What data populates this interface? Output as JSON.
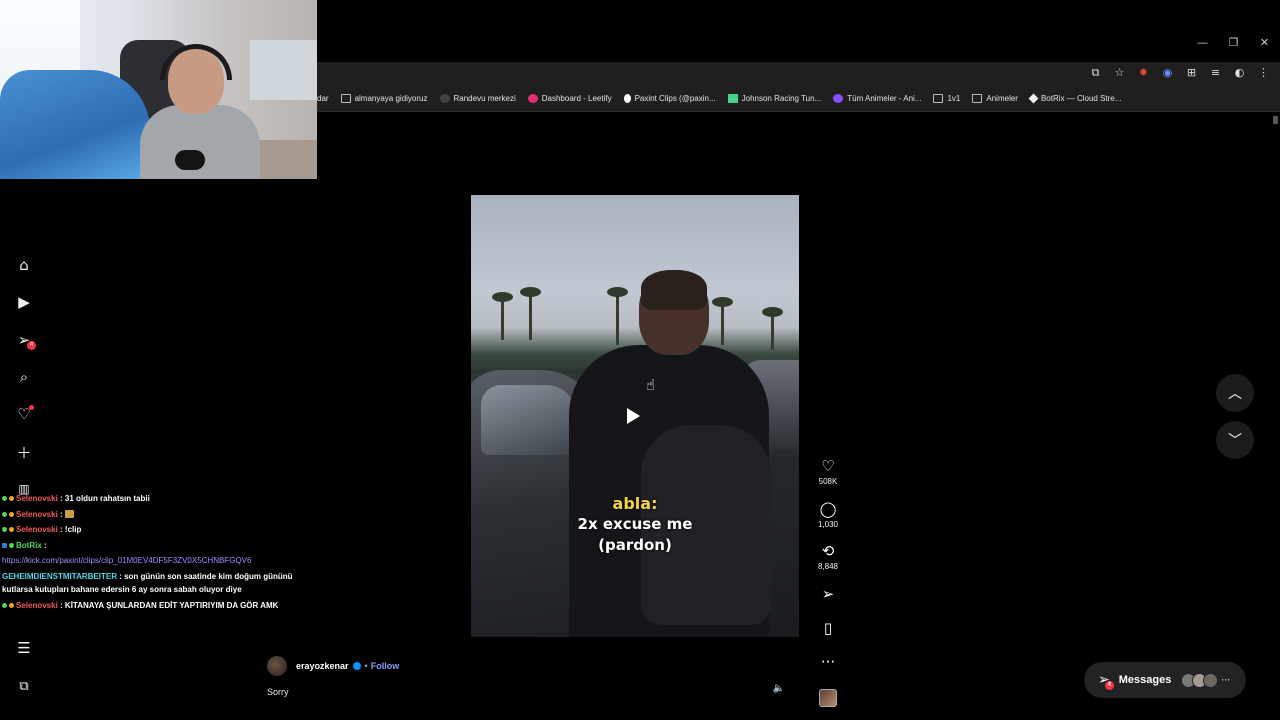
{
  "window": {
    "minimize": "—",
    "restore": "❐",
    "close": "✕"
  },
  "toolbar": {
    "icons": [
      "cast-icon",
      "star-icon",
      "extension-red-icon",
      "extension-blue-icon",
      "puzzle-icon",
      "media-icon",
      "profile-icon",
      "kebab-icon"
    ]
  },
  "bookmarks": [
    {
      "label": "dar",
      "icon": "none"
    },
    {
      "label": "almanyaya gidiyoruz",
      "icon": "folder"
    },
    {
      "label": "Randevu merkezi",
      "icon": "dark"
    },
    {
      "label": "Dashboard - Leetify",
      "icon": "pink"
    },
    {
      "label": "Paxint Clips (@paxin...",
      "icon": "tiktok"
    },
    {
      "label": "Johnson Racing Tun...",
      "icon": "green"
    },
    {
      "label": "Tüm Animeler - Ani...",
      "icon": "purple"
    },
    {
      "label": "1v1",
      "icon": "folder"
    },
    {
      "label": "Animeler",
      "icon": "folder"
    },
    {
      "label": "BotRix — Cloud Stre...",
      "icon": "botrix"
    }
  ],
  "nav": {
    "notifications_badge": "4"
  },
  "chat": {
    "line1_nick": "Selenovski",
    "line1_msg": ": 31 oldun rahatsın tabii",
    "line2_nick": "Selenovski",
    "line2_msg": ":",
    "line3_nick": "Selenovski",
    "line3_msg": ": !clip",
    "line4_nick": "BotRix",
    "line4_msg": ":",
    "line5_link": "https://kick.com/paxint/clips/clip_01M0EV4DF5F3ZV0X5CHNBFGQV6",
    "line6_nick": "GEHEIMDIENSTMITARBEITER",
    "line6_msg": ": son günün son saatinde kim doğum gününü kutlarsa kutupları bahane edersin 6 ay sonra sabah oluyor diye",
    "line7_nick": "Selenovski",
    "line7_msg": ": KİTANAYA ŞUNLARDAN EDİT YAPTIRIYIM DA GÖR AMK"
  },
  "video": {
    "caption_speaker": "abla:",
    "caption_line1": "2x excuse me",
    "caption_line2": "(pardon)"
  },
  "actions": {
    "likes": "508K",
    "comments": "1,030",
    "reposts": "8,848"
  },
  "author": {
    "username": "erayozkenar",
    "separator": "•",
    "follow": "Follow",
    "caption": "Sorry"
  },
  "messages": {
    "label": "Messages",
    "badge": "4",
    "more": "···"
  }
}
